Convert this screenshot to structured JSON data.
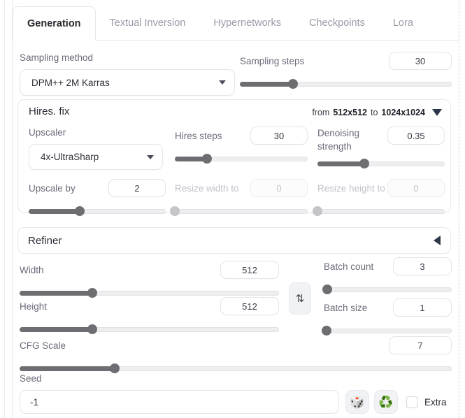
{
  "tabs": [
    {
      "label": "Generation",
      "active": true
    },
    {
      "label": "Textual Inversion",
      "active": false
    },
    {
      "label": "Hypernetworks",
      "active": false
    },
    {
      "label": "Checkpoints",
      "active": false
    },
    {
      "label": "Lora",
      "active": false
    }
  ],
  "sampling": {
    "method_label": "Sampling method",
    "method_value": "DPM++ 2M Karras",
    "steps_label": "Sampling steps",
    "steps_value": "30",
    "steps_fill_pct": 25
  },
  "hires": {
    "title": "Hires. fix",
    "range_prefix": "from",
    "range_from": "512x512",
    "range_mid": "to",
    "range_to": "1024x1024",
    "collapse_icon": "triangle-down",
    "upscaler_label": "Upscaler",
    "upscaler_value": "4x-UltraSharp",
    "hires_steps_label": "Hires steps",
    "hires_steps_value": "30",
    "hires_steps_fill_pct": 24,
    "denoising_label_line1": "Denoising",
    "denoising_label_line2": "strength",
    "denoising_value": "0.35",
    "denoising_fill_pct": 37,
    "upscale_by_label": "Upscale by",
    "upscale_by_value": "2",
    "upscale_by_fill_pct": 37,
    "resize_width_label": "Resize width to",
    "resize_width_value": "0",
    "resize_width_fill_pct": 0,
    "resize_height_label": "Resize height to",
    "resize_height_value": "0",
    "resize_height_fill_pct": 0
  },
  "refiner": {
    "title": "Refiner",
    "expand_icon": "triangle-left"
  },
  "dimensions": {
    "width_label": "Width",
    "width_value": "512",
    "width_fill_pct": 28,
    "height_label": "Height",
    "height_value": "512",
    "height_fill_pct": 28,
    "swap_icon": "⇅",
    "batch_count_label": "Batch count",
    "batch_count_value": "3",
    "batch_count_fill_pct": 3,
    "batch_size_label": "Batch size",
    "batch_size_value": "1",
    "batch_size_fill_pct": 2
  },
  "cfg": {
    "label": "CFG Scale",
    "value": "7",
    "fill_pct": 22
  },
  "seed": {
    "label": "Seed",
    "value": "-1",
    "dice_icon": "🎲",
    "recycle_icon": "♻️",
    "extra_label": "Extra",
    "extra_checked": false
  },
  "colors": {
    "slider_fill": "#6e6e72",
    "slider_track": "#eeeef0",
    "label_text": "#6b6b7b",
    "active_tab_text": "#27272e",
    "inactive_tab_text": "#9a9aa8"
  }
}
